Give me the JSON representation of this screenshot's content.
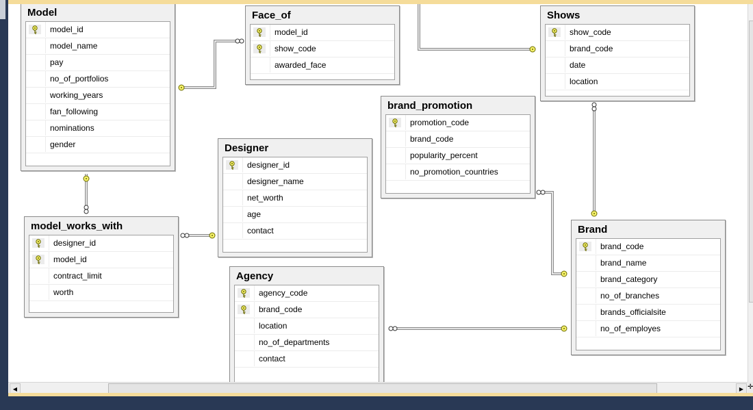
{
  "diagram": {
    "tables": [
      {
        "id": "model",
        "name": "Model",
        "columns": [
          {
            "name": "model_id",
            "pk": true
          },
          {
            "name": "model_name",
            "pk": false
          },
          {
            "name": "pay",
            "pk": false
          },
          {
            "name": "no_of_portfolios",
            "pk": false
          },
          {
            "name": "working_years",
            "pk": false
          },
          {
            "name": "fan_following",
            "pk": false
          },
          {
            "name": "nominations",
            "pk": false
          },
          {
            "name": "gender",
            "pk": false
          }
        ]
      },
      {
        "id": "face_of",
        "name": "Face_of",
        "columns": [
          {
            "name": "model_id",
            "pk": true
          },
          {
            "name": "show_code",
            "pk": true
          },
          {
            "name": "awarded_face",
            "pk": false
          }
        ]
      },
      {
        "id": "shows",
        "name": "Shows",
        "columns": [
          {
            "name": "show_code",
            "pk": true
          },
          {
            "name": "brand_code",
            "pk": false
          },
          {
            "name": "date",
            "pk": false
          },
          {
            "name": "location",
            "pk": false
          }
        ]
      },
      {
        "id": "brand_promotion",
        "name": "brand_promotion",
        "columns": [
          {
            "name": "promotion_code",
            "pk": true
          },
          {
            "name": "brand_code",
            "pk": false
          },
          {
            "name": "popularity_percent",
            "pk": false
          },
          {
            "name": "no_promotion_countries",
            "pk": false
          }
        ]
      },
      {
        "id": "designer",
        "name": "Designer",
        "columns": [
          {
            "name": "designer_id",
            "pk": true
          },
          {
            "name": "designer_name",
            "pk": false
          },
          {
            "name": "net_worth",
            "pk": false
          },
          {
            "name": "age",
            "pk": false
          },
          {
            "name": "contact",
            "pk": false
          }
        ]
      },
      {
        "id": "model_works_with",
        "name": "model_works_with",
        "columns": [
          {
            "name": "designer_id",
            "pk": true
          },
          {
            "name": "model_id",
            "pk": true
          },
          {
            "name": "contract_limit",
            "pk": false
          },
          {
            "name": "worth",
            "pk": false
          }
        ]
      },
      {
        "id": "agency",
        "name": "Agency",
        "columns": [
          {
            "name": "agency_code",
            "pk": true
          },
          {
            "name": "brand_code",
            "pk": true
          },
          {
            "name": "location",
            "pk": false
          },
          {
            "name": "no_of_departments",
            "pk": false
          },
          {
            "name": "contact",
            "pk": false
          }
        ]
      },
      {
        "id": "brand",
        "name": "Brand",
        "columns": [
          {
            "name": "brand_code",
            "pk": true
          },
          {
            "name": "brand_name",
            "pk": false
          },
          {
            "name": "brand_category",
            "pk": false
          },
          {
            "name": "no_of_branches",
            "pk": false
          },
          {
            "name": "brands_officialsite",
            "pk": false
          },
          {
            "name": "no_of_employes",
            "pk": false
          }
        ]
      }
    ],
    "relationships": [
      {
        "from": "model",
        "to": "face_of",
        "one_end": "model",
        "many_end": "face_of"
      },
      {
        "from": "shows",
        "to": "face_of",
        "one_end": "shows",
        "many_end": "face_of"
      },
      {
        "from": "model",
        "to": "model_works_with",
        "one_end": "model",
        "many_end": "model_works_with"
      },
      {
        "from": "designer",
        "to": "model_works_with",
        "one_end": "designer",
        "many_end": "model_works_with"
      },
      {
        "from": "brand",
        "to": "shows",
        "one_end": "brand",
        "many_end": "shows"
      },
      {
        "from": "brand",
        "to": "brand_promotion",
        "one_end": "brand",
        "many_end": "brand_promotion"
      },
      {
        "from": "brand",
        "to": "agency",
        "one_end": "brand",
        "many_end": "agency"
      }
    ]
  },
  "colors": {
    "key": "#f4f06a",
    "connector": "#8c8c8c",
    "background": "#293955",
    "accent": "#f5dc9a"
  },
  "icons": {
    "primary_key": "key-icon",
    "one_end": "key-connector-icon",
    "many_end": "infinity-icon"
  },
  "scroll": {
    "left_arrow": "◀",
    "right_arrow": "▶",
    "corner": "✛"
  }
}
